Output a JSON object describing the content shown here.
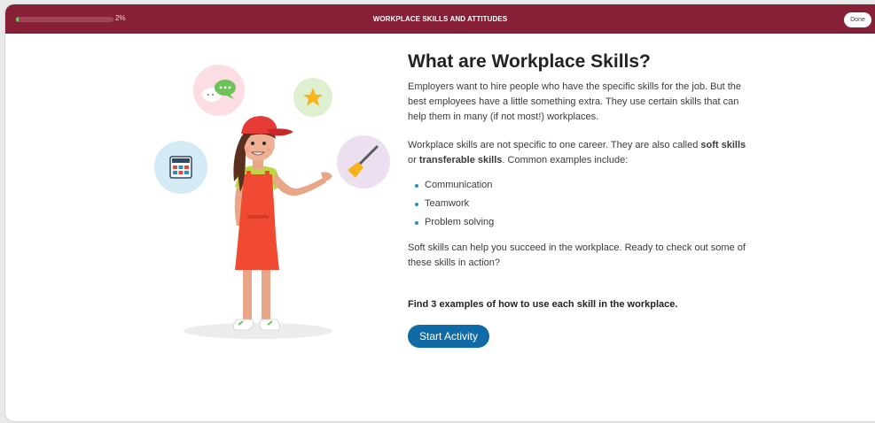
{
  "header": {
    "progress_percent": 2,
    "progress_label": "2%",
    "title": "WORKPLACE SKILLS AND ATTITUDES",
    "done_label": "Done"
  },
  "main": {
    "heading": "What are Workplace Skills?",
    "intro": "Employers want to hire people who have the specific skills for the job. But the best employees have a little something extra. They use certain skills that can help them in many (if not most!) workplaces.",
    "soft_skills": {
      "before": "Workplace skills are not specific to one career. They are also called ",
      "term1": "soft skills",
      "between": " or ",
      "term2": "transferable skills",
      "after": ". Common examples include:"
    },
    "examples": [
      "Communication",
      "Teamwork",
      "Problem solving"
    ],
    "closing": "Soft skills can help you succeed in the workplace. Ready to check out some of these skills in action?",
    "instruction": "Find 3 examples of how to use each skill in the workplace.",
    "start_label": "Start Activity"
  },
  "illustration": {
    "icons": [
      "speech-bubbles-icon",
      "star-icon",
      "calculator-icon",
      "broom-icon"
    ],
    "colors": {
      "speech_circle": "#fbdde3",
      "star_circle": "#dff0d0",
      "calculator_circle": "#d4ebf6",
      "broom_circle": "#ecdff0",
      "apron": "#f04a32",
      "cap": "#e53a35",
      "shirt": "#bfd343"
    }
  },
  "colors": {
    "header_bg": "#862037",
    "progress_fill": "#6fca57",
    "accent_button": "#0f6aa6",
    "bullet": "#2a8fc4"
  }
}
